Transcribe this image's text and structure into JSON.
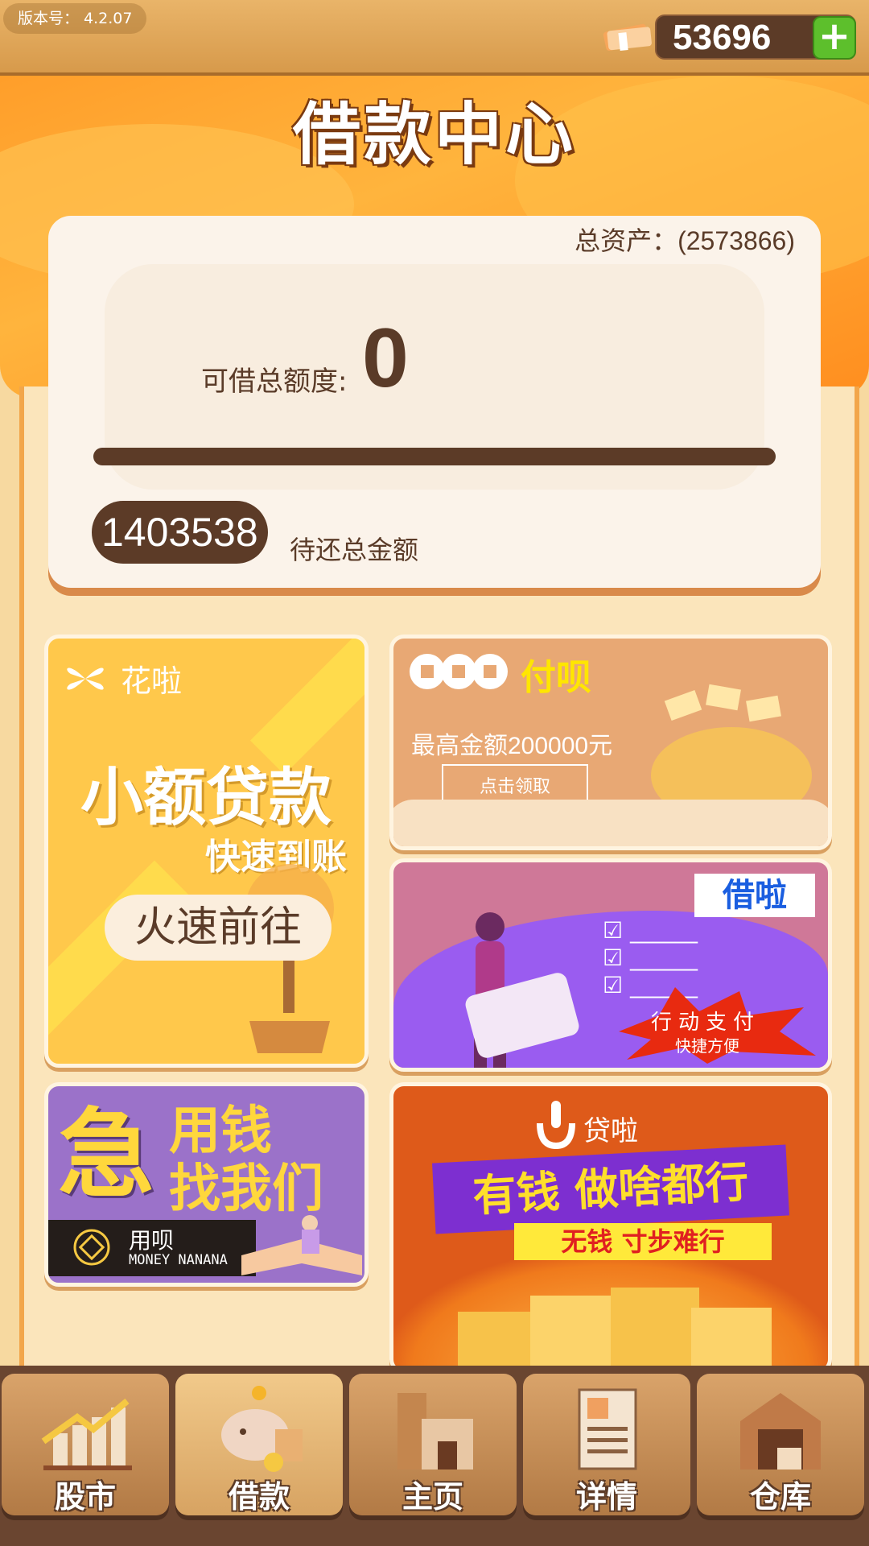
{
  "header": {
    "version_label": "版本号：  4.2.07",
    "coins": "53696",
    "plus": "+"
  },
  "title": "借款中心",
  "assets": {
    "total_assets": "总资产：(2573866)",
    "limit_label": "可借总额度:",
    "limit_value": "0",
    "limit_fraction": 0,
    "due_value": "1403538",
    "due_label": "待还总金额"
  },
  "tiles": {
    "hua": {
      "brand": "花啦",
      "big": "小额贷款",
      "sub": "快速到账",
      "button": "火速前往"
    },
    "fu": {
      "brand": "付呗",
      "desc": "最高金额200000元",
      "button": "点击领取"
    },
    "jie": {
      "brand": "借啦",
      "pay": "行动支付",
      "fast": "快捷方便"
    },
    "yong": {
      "big1": "急",
      "big2": "用钱",
      "big3": "找我们",
      "brand": "用呗",
      "en": "MONEY NANANA"
    },
    "dai": {
      "brand": "贷啦",
      "slogan1": "有钱  做啥都行",
      "slogan2": "无钱  寸步难行"
    }
  },
  "nav": [
    {
      "label": "股市",
      "icon": "stock-chart-icon"
    },
    {
      "label": "借款",
      "icon": "piggy-bank-icon"
    },
    {
      "label": "主页",
      "icon": "house-icon"
    },
    {
      "label": "详情",
      "icon": "profile-card-icon"
    },
    {
      "label": "仓库",
      "icon": "warehouse-icon"
    }
  ],
  "colors": {
    "accent": "#f2a64a",
    "dark_brown": "#5c3b27",
    "banner_orange": "#ff9e2a",
    "plus_green": "#5dbf2c"
  }
}
